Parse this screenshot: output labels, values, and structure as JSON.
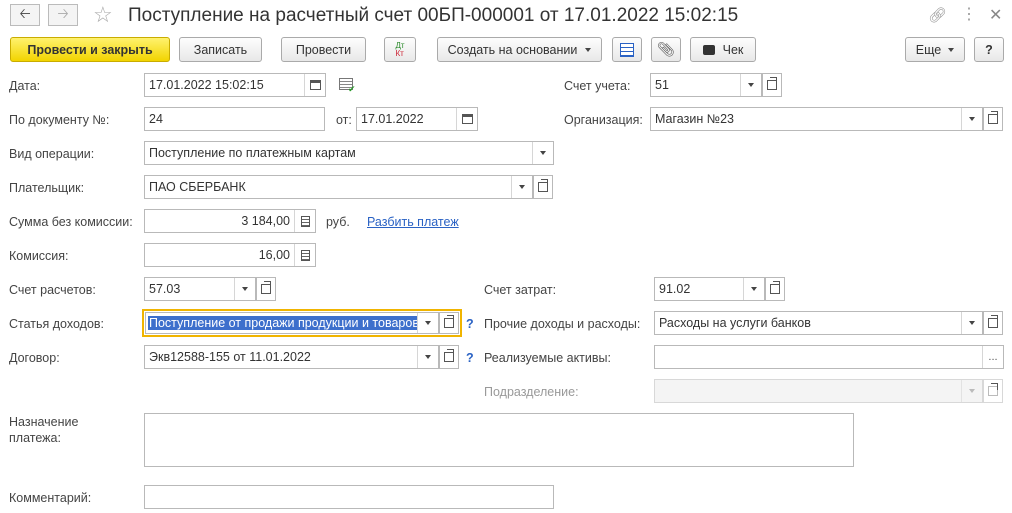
{
  "window": {
    "title": "Поступление на расчетный счет 00БП-000001 от 17.01.2022 15:02:15"
  },
  "toolbar": {
    "post_close": "Провести и закрыть",
    "save": "Записать",
    "post": "Провести",
    "dtkt": "Дт Кт",
    "create_based": "Создать на основании",
    "receipt": "Чек",
    "more": "Еще",
    "help": "?"
  },
  "form": {
    "date": {
      "label": "Дата:",
      "value": "17.01.2022 15:02:15"
    },
    "doc_number": {
      "label": "По документу №:",
      "value": "24",
      "from_label": "от:",
      "from_value": "17.01.2022"
    },
    "operation_type": {
      "label": "Вид операции:",
      "value": "Поступление по платежным картам"
    },
    "payer": {
      "label": "Плательщик:",
      "value": "ПАО СБЕРБАНК"
    },
    "amount": {
      "label": "Сумма без комиссии:",
      "value": "3 184,00",
      "currency": "руб.",
      "split_link": "Разбить платеж"
    },
    "commission": {
      "label": "Комиссия:",
      "value": "16,00"
    },
    "settlement_account": {
      "label": "Счет расчетов:",
      "value": "57.03"
    },
    "income_item": {
      "label": "Статья доходов:",
      "value": "Поступление от продажи продукции и товаров",
      "help": "?"
    },
    "contract": {
      "label": "Договор:",
      "value": "Экв12588-155 от 11.01.2022",
      "help": "?"
    },
    "purpose": {
      "label": "Назначение платежа:",
      "value": ""
    },
    "comment": {
      "label": "Комментарий:",
      "value": ""
    },
    "account": {
      "label": "Счет учета:",
      "value": "51"
    },
    "organization": {
      "label": "Организация:",
      "value": "Магазин №23"
    },
    "expense_account": {
      "label": "Счет затрат:",
      "value": "91.02"
    },
    "other_income": {
      "label": "Прочие доходы и расходы:",
      "value": "Расходы на услуги банков"
    },
    "sold_assets": {
      "label": "Реализуемые активы:",
      "value": "",
      "more": "..."
    },
    "department": {
      "label": "Подразделение:",
      "value": ""
    }
  },
  "colors": {
    "primary_button": "#f2d400",
    "focus_border": "#f0b400",
    "link": "#2a62c4",
    "selection": "#3d6fcc"
  }
}
